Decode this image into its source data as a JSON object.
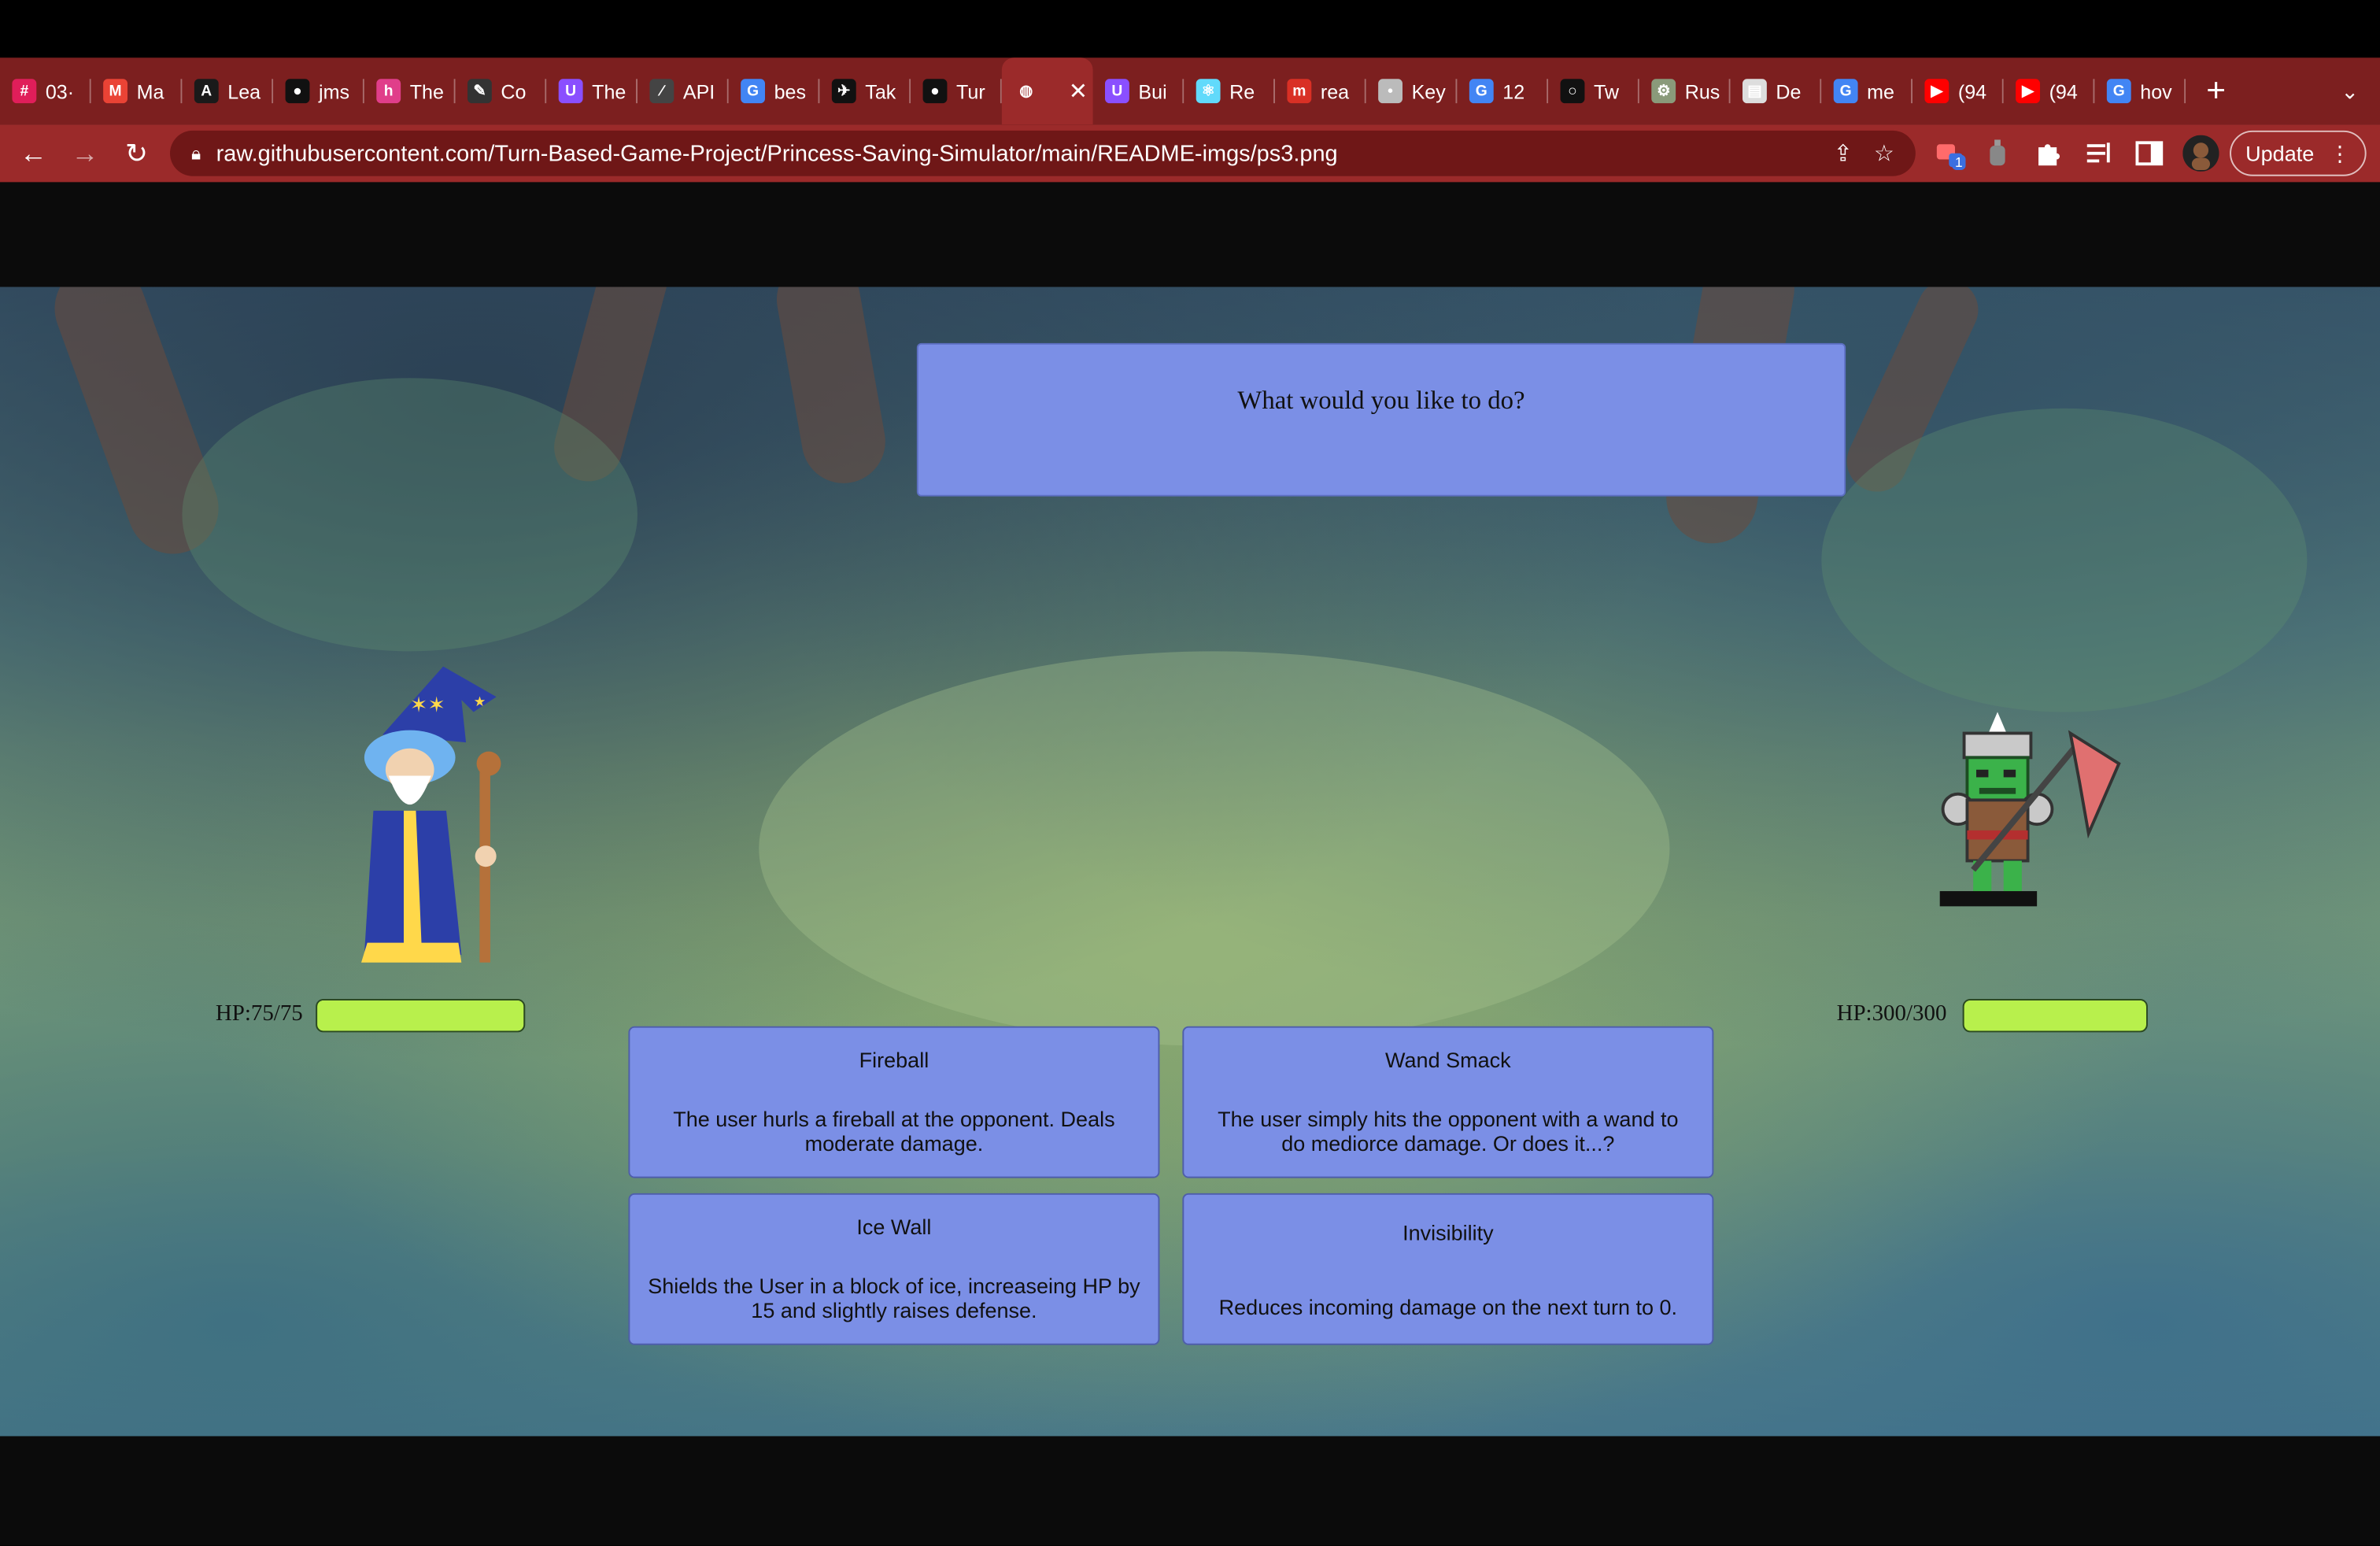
{
  "browser": {
    "tabs": [
      {
        "label": "03·",
        "icon": "slack-icon",
        "color": "#e01e5a"
      },
      {
        "label": "Ma",
        "icon": "gmail-icon",
        "color": "#ea4335"
      },
      {
        "label": "Lea",
        "icon": "leetcode-icon",
        "color": "#1a1a1a"
      },
      {
        "label": "jms",
        "icon": "github-icon",
        "color": "#111111"
      },
      {
        "label": "The",
        "icon": "hackmd-icon",
        "color": "#e03e8a"
      },
      {
        "label": "Co",
        "icon": "notebook-icon",
        "color": "#333333"
      },
      {
        "label": "The",
        "icon": "udemy-icon",
        "color": "#8a4fff"
      },
      {
        "label": "API",
        "icon": "api-icon",
        "color": "#444444"
      },
      {
        "label": "bes",
        "icon": "google-icon",
        "color": "#4285f4"
      },
      {
        "label": "Tak",
        "icon": "takeout-icon",
        "color": "#111111"
      },
      {
        "label": "Tur",
        "icon": "github-icon",
        "color": "#111111"
      },
      {
        "label": "",
        "icon": "globe-icon",
        "color": "#ffffff",
        "active": true
      },
      {
        "label": "Bui",
        "icon": "udemy-icon",
        "color": "#8a4fff"
      },
      {
        "label": "Re",
        "icon": "react-icon",
        "color": "#61dafb"
      },
      {
        "label": "rea",
        "icon": "medium-icon",
        "color": "#d93025"
      },
      {
        "label": "Key",
        "icon": "apple-icon",
        "color": "#bbbbbb"
      },
      {
        "label": "12",
        "icon": "google-icon",
        "color": "#4285f4"
      },
      {
        "label": "Tw",
        "icon": "circle-icon",
        "color": "#111111"
      },
      {
        "label": "Rus",
        "icon": "rust-icon",
        "color": "#8a9a7a"
      },
      {
        "label": "De",
        "icon": "doc-icon",
        "color": "#dddddd"
      },
      {
        "label": "me",
        "icon": "google-icon",
        "color": "#4285f4"
      },
      {
        "label": "(94",
        "icon": "youtube-icon",
        "color": "#ff0000"
      },
      {
        "label": "(94",
        "icon": "youtube-icon",
        "color": "#ff0000"
      },
      {
        "label": "hov",
        "icon": "google-icon",
        "color": "#4285f4"
      }
    ],
    "url": "raw.githubusercontent.com/Turn-Based-Game-Project/Princess-Saving-Simulator/main/README-imgs/ps3.png",
    "update_label": "Update",
    "extension_badge": "1"
  },
  "game": {
    "prompt": "What would you like to do?",
    "player": {
      "hp_text": "HP:75/75",
      "hp_fraction": 1.0
    },
    "enemy": {
      "hp_text": "HP:300/300",
      "hp_fraction": 1.0
    },
    "moves": [
      {
        "name": "Fireball",
        "description": "The user hurls a fireball at the opponent. Deals moderate damage."
      },
      {
        "name": "Wand Smack",
        "description": "The user simply hits the opponent with a wand to do mediorce damage. Or does it...?"
      },
      {
        "name": "Ice Wall",
        "description": "Shields the User in a block of ice, increaseing HP by 15 and slightly raises defense."
      },
      {
        "name": "Invisibility",
        "description": "Reduces incoming damage on the next turn to 0."
      }
    ]
  },
  "colors": {
    "tabstrip": "#7c1f1f",
    "toolbar": "#9b2a2a",
    "panel": "#7b8fe6",
    "hp_fill": "#b8f04c"
  }
}
